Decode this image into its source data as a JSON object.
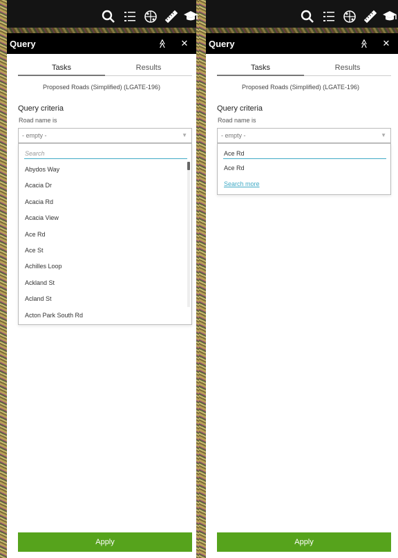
{
  "colors": {
    "header_bg": "#000000",
    "accent": "#3fa9c5",
    "apply": "#56a31c"
  },
  "toolbar": {
    "icons": [
      "search-icon",
      "list-icon",
      "palette-icon",
      "ruler-icon",
      "graduation-cap-icon"
    ]
  },
  "panels": [
    {
      "header": {
        "title": "Query",
        "collapse_glyph": "≫",
        "close_glyph": "✕"
      },
      "tabs": [
        {
          "label": "Tasks"
        },
        {
          "label": "Results"
        }
      ],
      "layer_name": "Proposed Roads (Simplified) (LGATE-196)",
      "criteria_title": "Query criteria",
      "criteria_label": "Road name is",
      "select_value": "- empty -",
      "search": {
        "placeholder": "Search",
        "value": ""
      },
      "items": [
        "Abydos Way",
        "Acacia Dr",
        "Acacia Rd",
        "Acacia View",
        "Ace Rd",
        "Ace St",
        "Achilles Loop",
        "Ackland St",
        "Acland St",
        "Acton Park South Rd"
      ],
      "apply_label": "Apply"
    },
    {
      "header": {
        "title": "Query",
        "collapse_glyph": "≫",
        "close_glyph": "✕"
      },
      "tabs": [
        {
          "label": "Tasks"
        },
        {
          "label": "Results"
        }
      ],
      "layer_name": "Proposed Roads (Simplified) (LGATE-196)",
      "criteria_title": "Query criteria",
      "criteria_label": "Road name is",
      "select_value": "- empty -",
      "search": {
        "placeholder": "",
        "value": "Ace Rd"
      },
      "items": [
        "Ace Rd"
      ],
      "search_more": "Search more",
      "apply_label": "Apply"
    }
  ]
}
